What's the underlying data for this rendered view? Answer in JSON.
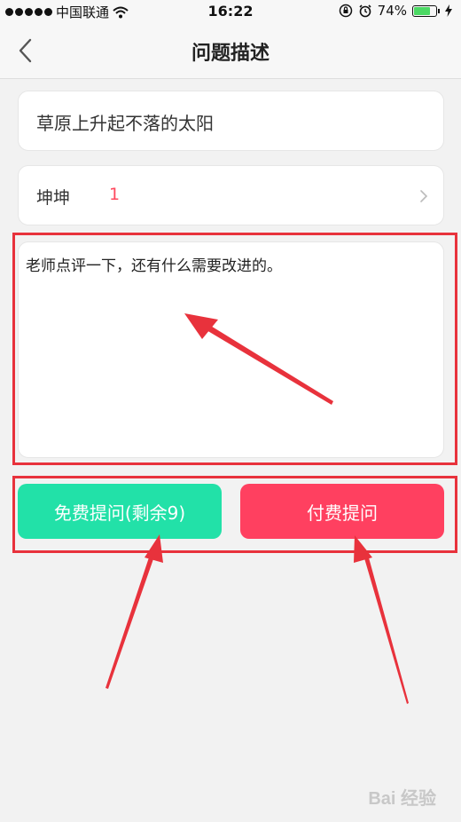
{
  "status_bar": {
    "carrier": "中国联通",
    "time": "16:22",
    "battery_percent": "74%",
    "battery_level": 0.74,
    "icons": [
      "signal-dots-icon",
      "wifi-icon",
      "orientation-lock-icon",
      "alarm-icon",
      "battery-icon",
      "charging-icon"
    ]
  },
  "nav": {
    "title": "问题描述",
    "back_icon": "chevron-left-icon"
  },
  "topic": {
    "text": "草原上升起不落的太阳"
  },
  "teacher": {
    "name": "坤坤",
    "count": "1",
    "chevron_icon": "chevron-right-icon"
  },
  "description": {
    "value": "老师点评一下，还有什么需要改进的。"
  },
  "buttons": {
    "free_label": "免费提问(剩余9)",
    "paid_label": "付费提问"
  },
  "watermark": {
    "text": "Bai 经验"
  },
  "colors": {
    "accent_green": "#22e1a8",
    "accent_red": "#ff4060",
    "count_red": "#ff4a5f",
    "annotation_red": "#e8323c",
    "background": "#f2f2f2"
  }
}
